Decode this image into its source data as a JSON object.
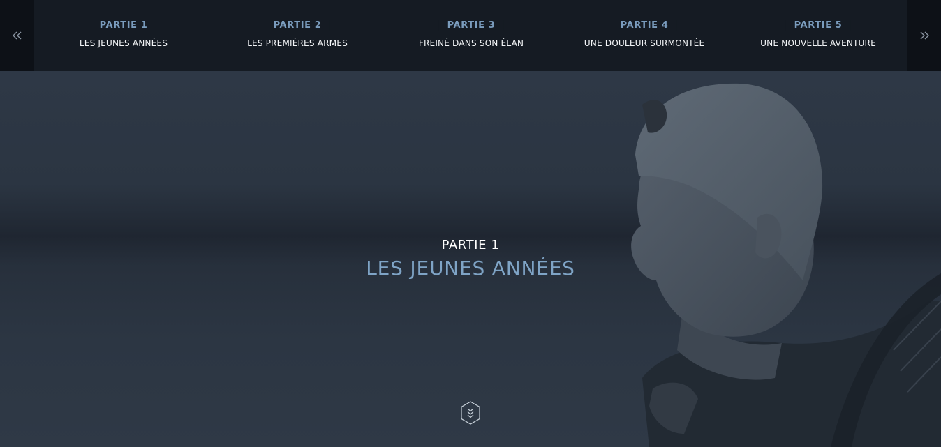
{
  "nav": {
    "prev_icon": "double-chevron-left-icon",
    "next_icon": "double-chevron-right-icon",
    "parts": [
      {
        "label": "PARTIE 1",
        "title": "LES JEUNES ANNÉES"
      },
      {
        "label": "PARTIE 2",
        "title": "LES PREMIÈRES ARMES"
      },
      {
        "label": "PARTIE 3",
        "title": "FREINÉ DANS SON ÉLAN"
      },
      {
        "label": "PARTIE 4",
        "title": "UNE DOULEUR SURMONTÉE"
      },
      {
        "label": "PARTIE 5",
        "title": "UNE NOUVELLE AVENTURE"
      }
    ]
  },
  "hero": {
    "label": "PARTIE 1",
    "title": "LES JEUNES ANNÉES",
    "scroll_icon": "hexagon-chevrons-down-icon"
  },
  "colors": {
    "accent": "#7fa4c6",
    "topbar": "#151b23",
    "hero_bg": "#2a3340"
  }
}
